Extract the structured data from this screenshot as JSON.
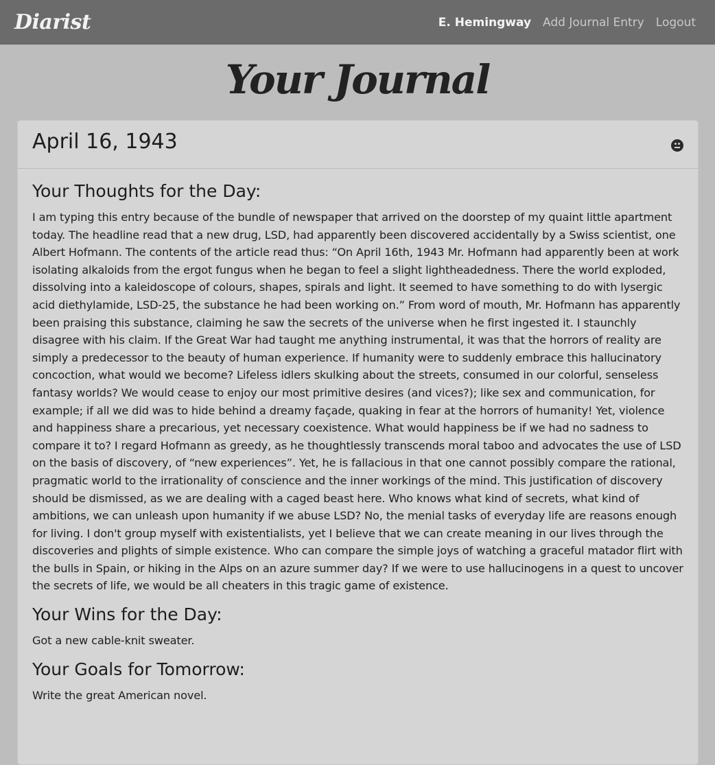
{
  "navbar": {
    "brand": "Diarist",
    "links": [
      {
        "label": "E. Hemingway",
        "active": true
      },
      {
        "label": "Add Journal Entry",
        "active": false
      },
      {
        "label": "Logout",
        "active": false
      }
    ]
  },
  "page": {
    "title": "Your Journal"
  },
  "entry": {
    "date": "April 16, 1943",
    "mood_icon": "neutral-face-icon",
    "sections": [
      {
        "heading": "Your Thoughts for the Day:",
        "text": "I am typing this entry because of the bundle of newspaper that arrived on the doorstep of my quaint little apartment today. The headline read that a new drug, LSD, had apparently been discovered accidentally by a Swiss scientist, one Albert Hofmann. The contents of the article read thus: “On April 16th, 1943 Mr. Hofmann had apparently been at work isolating alkaloids from the ergot fungus when he began to feel a slight lightheadedness. There the world exploded, dissolving into a kaleidoscope of colours, shapes, spirals and light. It seemed to have something to do with lysergic acid diethylamide, LSD-25, the substance he had been working on.” From word of mouth, Mr. Hofmann has apparently been praising this substance, claiming he saw the secrets of the universe when he first ingested it. I staunchly disagree with his claim. If the Great War had taught me anything instrumental, it was that the horrors of reality are simply a predecessor to the beauty of human experience. If humanity were to suddenly embrace this hallucinatory concoction, what would we become? Lifeless idlers skulking about the streets, consumed in our colorful, senseless fantasy worlds? We would cease to enjoy our most primitive desires (and vices?); like sex and communication, for example; if all we did was to hide behind a dreamy façade, quaking in fear at the horrors of humanity! Yet, violence and happiness share a precarious, yet necessary coexistence. What would happiness be if we had no sadness to compare it to? I regard Hofmann as greedy, as he thoughtlessly transcends moral taboo and advocates the use of LSD on the basis of discovery, of “new experiences”. Yet, he is fallacious in that one cannot possibly compare the rational, pragmatic world to the irrationality of conscience and the inner workings of the mind. This justification of discovery should be dismissed, as we are dealing with a caged beast here. Who knows what kind of secrets, what kind of ambitions, we can unleash upon humanity if we abuse LSD? No, the menial tasks of everyday life are reasons enough for living. I don't group myself with existentialists, yet I believe that we can create meaning in our lives through the discoveries and plights of simple existence. Who can compare the simple joys of watching a graceful matador flirt with the bulls in Spain, or hiking in the Alps on an azure summer day? If we were to use hallucinogens in a quest to uncover the secrets of life, we would be all cheaters in this tragic game of existence."
      },
      {
        "heading": "Your Wins for the Day:",
        "text": "Got a new cable-knit sweater."
      },
      {
        "heading": "Your Goals for Tomorrow:",
        "text": "Write the great American novel."
      }
    ]
  }
}
